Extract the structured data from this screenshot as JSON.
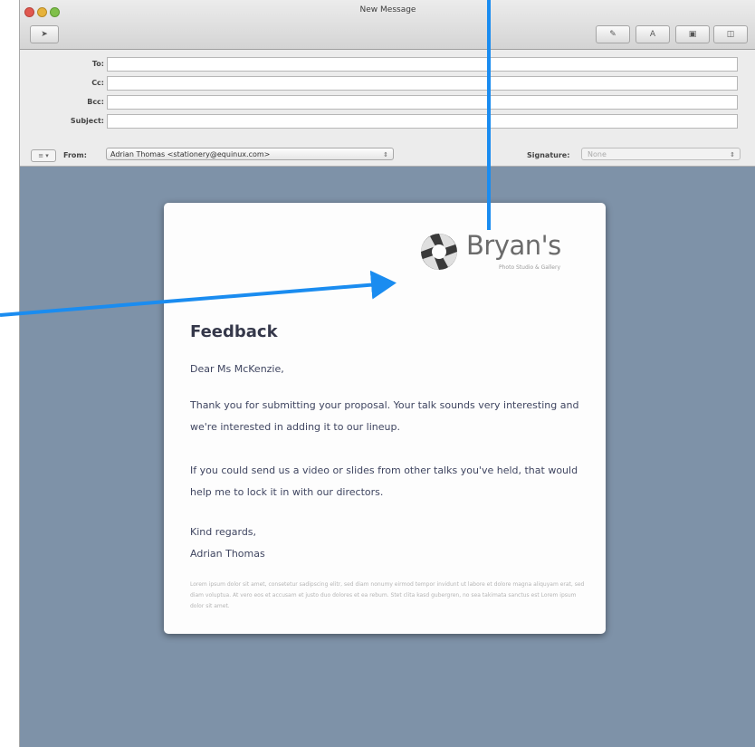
{
  "window": {
    "title": "New Message"
  },
  "toolbar": {
    "send_glyph": "➤",
    "attach_glyph": "✎",
    "font_glyph": "A",
    "photo_glyph": "▣",
    "stationery_glyph": "◫"
  },
  "headers": {
    "to_label": "To:",
    "cc_label": "Cc:",
    "bcc_label": "Bcc:",
    "subject_label": "Subject:",
    "to_value": "",
    "cc_value": "",
    "bcc_value": "",
    "subject_value": "",
    "options_label": "≡ ▾",
    "from_label": "From:",
    "from_value": "Adrian Thomas <stationery@equinux.com>",
    "signature_label": "Signature:",
    "signature_value": "None",
    "select_arrow": "⇕"
  },
  "stationery": {
    "logo_name": "Bryan's",
    "logo_tagline": "Photo Studio & Gallery",
    "title": "Feedback",
    "greeting": "Dear Ms McKenzie,",
    "paragraph1": "Thank you for submitting your proposal. Your talk sounds very interesting and we're interested in adding it to our lineup.",
    "paragraph2": "If you could send us a video or slides from other talks you've held, that would help me to lock it in with our directors.",
    "closing_line1": "Kind regards,",
    "closing_line2": "Adrian Thomas",
    "footer": "Lorem ipsum dolor sit amet, consetetur sadipscing elitr, sed diam nonumy eirmod tempor invidunt ut labore et dolore magna aliquyam erat, sed diam voluptua. At vero eos et accusam et justo duo dolores et ea rebum. Stet clita kasd gubergren, no sea takimata sanctus est Lorem ipsum dolor sit amet."
  },
  "colors": {
    "body_background": "#7e92a8",
    "annotation_arrow": "#1a8cf0"
  }
}
